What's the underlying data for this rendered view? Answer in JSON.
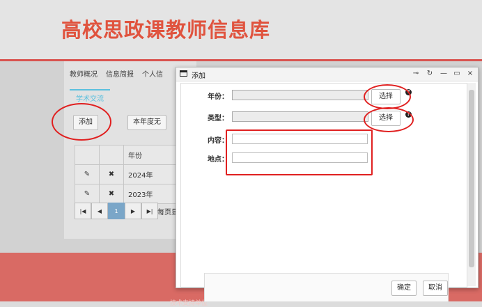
{
  "site": {
    "title": "高校思政课教师信息库"
  },
  "nav": [
    "教师概况",
    "信息简报",
    "个人信"
  ],
  "subtab": "学术交流",
  "buttons": {
    "add": "添加",
    "this_year": "本年度无"
  },
  "table": {
    "header": "年份",
    "rows": [
      "2024年",
      "2023年"
    ]
  },
  "pager": {
    "first": "|◀",
    "prev": "◀",
    "page": "1",
    "next": "▶",
    "last": "▶|",
    "per_page": "每页显"
  },
  "dialog": {
    "title": "添加",
    "controls": [
      "⊸",
      "↻",
      "—",
      "▭",
      "×"
    ],
    "fields": {
      "year_label": "年份：",
      "type_label": "类型：",
      "content_label": "内容：",
      "location_label": "地点："
    },
    "select_label": "选择",
    "help": "?",
    "confirm": "确定",
    "cancel": "取消"
  },
  "footer": {
    "text": "技术支持单位"
  },
  "colors": {
    "brand": "#e0533e",
    "accent": "#5bc0de",
    "highlight": "#e02020"
  }
}
